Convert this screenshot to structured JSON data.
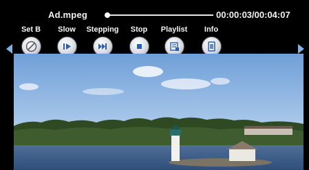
{
  "player": {
    "filename": "Ad.mpeg",
    "timecode": "00:00:03/00:04:07",
    "progress_fraction": 0.012
  },
  "controls": [
    {
      "label": "Set B",
      "icon": "set-b-icon"
    },
    {
      "label": "Slow",
      "icon": "slow-play-icon"
    },
    {
      "label": "Stepping",
      "icon": "step-forward-icon"
    },
    {
      "label": "Stop",
      "icon": "stop-icon"
    },
    {
      "label": "Playlist",
      "icon": "playlist-icon"
    },
    {
      "label": "Info",
      "icon": "info-icon"
    }
  ],
  "colors": {
    "arrow": "#7fb3e6",
    "bar": "#000000",
    "text": "#f2f2f2"
  }
}
